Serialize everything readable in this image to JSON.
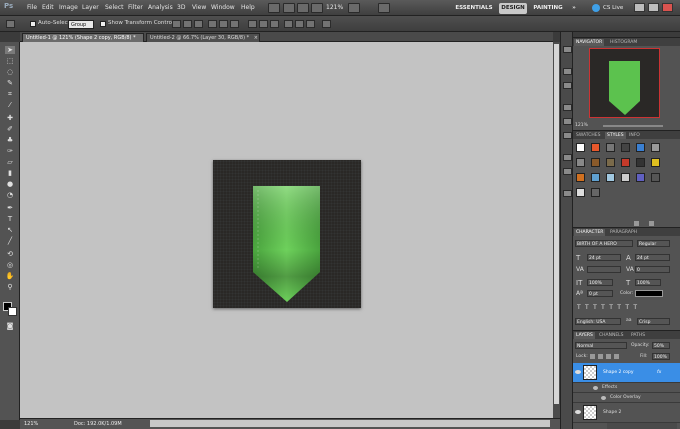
{
  "app": {
    "logo": "Ps"
  },
  "menu": [
    "File",
    "Edit",
    "Image",
    "Layer",
    "Select",
    "Filter",
    "Analysis",
    "3D",
    "View",
    "Window",
    "Help"
  ],
  "menubar": {
    "zoom": "121%",
    "workspaces": [
      "ESSENTIALS",
      "DESIGN",
      "PAINTING"
    ],
    "more": "»",
    "cs_live": "CS Live"
  },
  "options": {
    "auto_select": "Auto-Select:",
    "auto_select_value": "Group",
    "show_transform": "Show Transform Controls"
  },
  "tabs": [
    {
      "label": "Untitled-1 @ 121% (Shape 2 copy, RGB/8) *",
      "close": "×"
    },
    {
      "label": "Untitled-2 @ 66.7% (Layer 30, RGB/8) *",
      "close": "×"
    }
  ],
  "status": {
    "zoom": "121%",
    "doc": "Doc: 192.0K/1.09M"
  },
  "navigator": {
    "tabs": [
      "NAVIGATOR",
      "HISTOGRAM"
    ],
    "zoom": "121%"
  },
  "styles": {
    "tabs": [
      "SWATCHES",
      "STYLES",
      "INFO"
    ]
  },
  "character": {
    "tabs": [
      "CHARACTER",
      "PARAGRAPH"
    ],
    "font": "BIRTH OF A HERO",
    "style": "Regular",
    "size": "24 pt",
    "leading": "24 pt",
    "tracking": "0",
    "vscale": "100%",
    "hscale": "100%",
    "baseline": "0 pt",
    "color_label": "Color:",
    "language": "English: USA",
    "aa": "aa",
    "antialias": "Crisp"
  },
  "layers": {
    "tabs": [
      "LAYERS",
      "CHANNELS",
      "PATHS"
    ],
    "blend": "Normal",
    "opacity_label": "Opacity:",
    "opacity": "50%",
    "lock_label": "Lock:",
    "fill_label": "Fill:",
    "fill": "100%",
    "items": [
      {
        "name": "Shape 2 copy",
        "fx": "fx"
      },
      {
        "name": "Effects"
      },
      {
        "name": "Color Overlay"
      },
      {
        "name": "Shape 2"
      }
    ]
  },
  "colors": {
    "accent": "#3a8ee6",
    "ribbon": "#5cc24e",
    "canvas_bg": "#2a2826"
  }
}
